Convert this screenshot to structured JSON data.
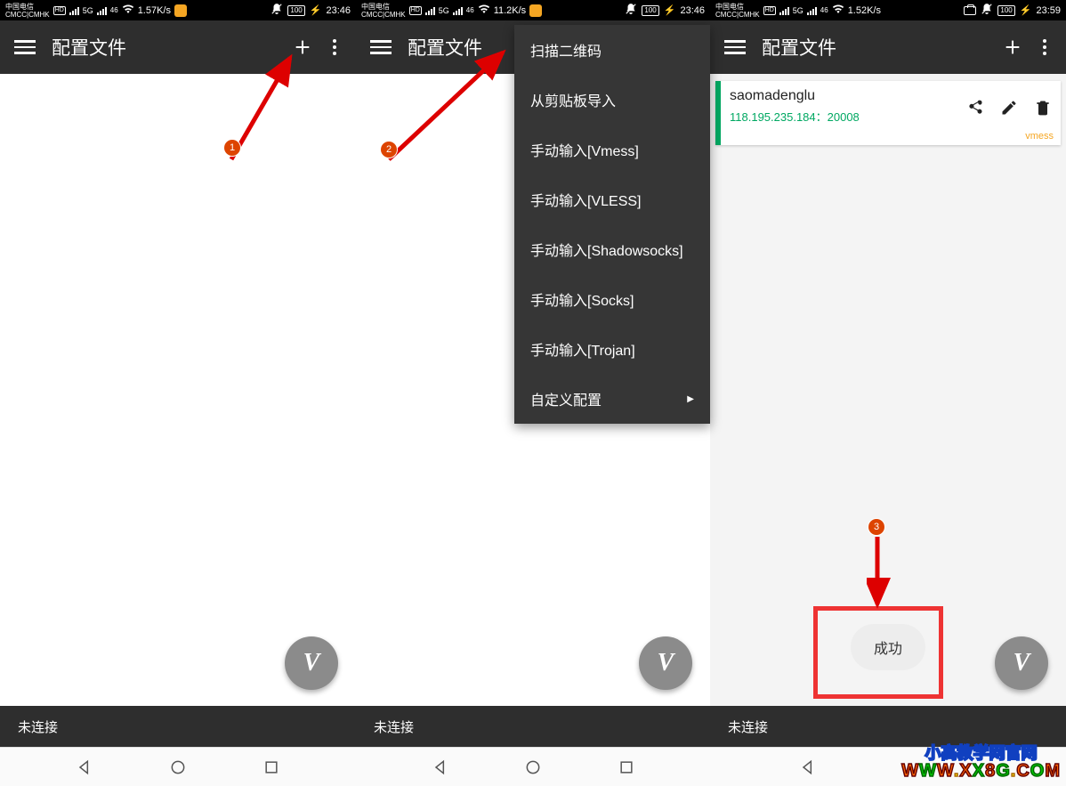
{
  "status": {
    "carrier_top": "中国电信",
    "carrier_bot": "CMCC|CMHK",
    "hd": "HD",
    "fiveg": "5G",
    "wifi_sub": "46",
    "speed1": "1.57K/s",
    "speed2": "11.2K/s",
    "speed3": "1.52K/s",
    "batt": "100",
    "time12": "23:46",
    "time3": "23:59"
  },
  "appbar": {
    "title": "配置文件"
  },
  "menu": {
    "items": [
      "扫描二维码",
      "从剪贴板导入",
      "手动输入[Vmess]",
      "手动输入[VLESS]",
      "手动输入[Shadowsocks]",
      "手动输入[Socks]",
      "手动输入[Trojan]"
    ],
    "custom": "自定义配置"
  },
  "card": {
    "name": "saomadenglu",
    "addr": "118.195.235.184：20008",
    "proto": "vmess"
  },
  "toast": "成功",
  "conn": "未连接",
  "fab": "V",
  "ann": {
    "n1": "1",
    "n2": "2",
    "n3": "3"
  },
  "wm": {
    "line1": "小高教学网官网",
    "url": "WWW.XX8G.COM"
  }
}
